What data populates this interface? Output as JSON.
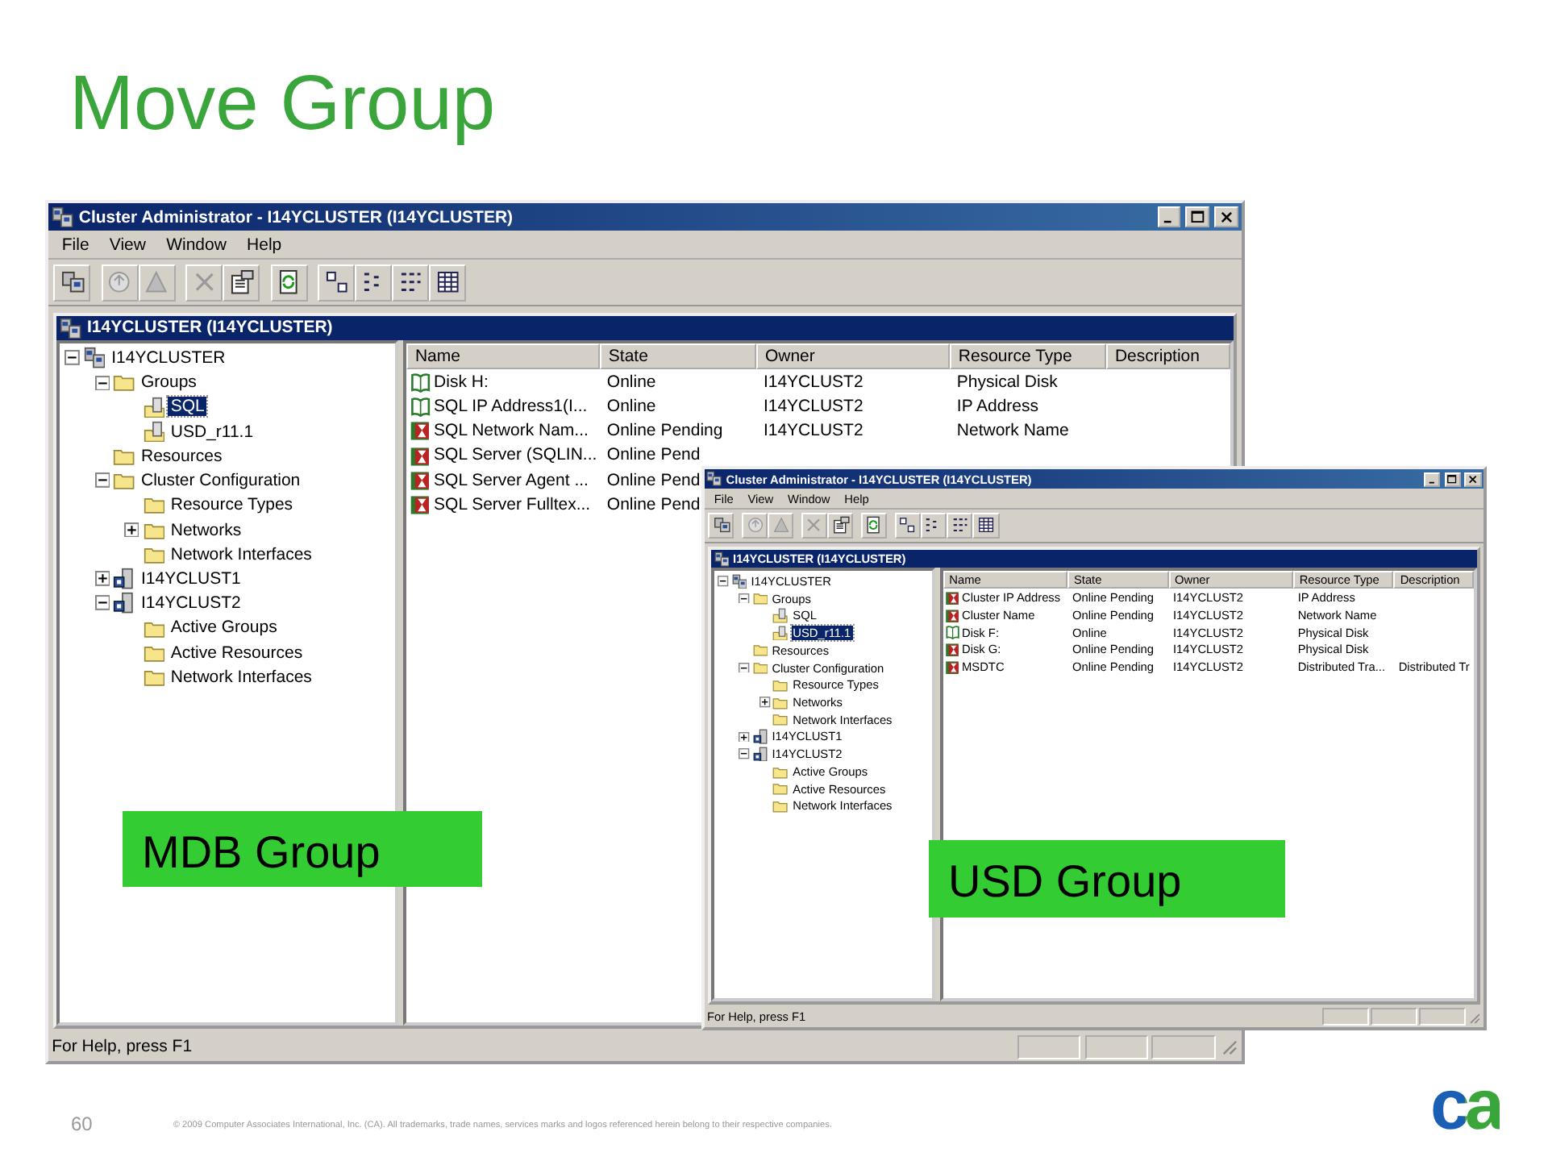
{
  "slide_title": "Move Group",
  "windows": [
    {
      "title": "Cluster Administrator - I14YCLUSTER (I14YCLUSTER)",
      "menu": [
        "File",
        "View",
        "Window",
        "Help"
      ],
      "child_title": "I14YCLUSTER (I14YCLUSTER)",
      "tree": [
        {
          "label": "I14YCLUSTER",
          "kind": "cluster",
          "expanded": true,
          "selected": false,
          "children": [
            {
              "label": "Groups",
              "kind": "folder",
              "expanded": true,
              "selected": false,
              "children": [
                {
                  "label": "SQL",
                  "kind": "group",
                  "selected": true
                },
                {
                  "label": "USD_r11.1",
                  "kind": "group",
                  "selected": false
                }
              ]
            },
            {
              "label": "Resources",
              "kind": "folder",
              "selected": false
            },
            {
              "label": "Cluster Configuration",
              "kind": "folder",
              "expanded": true,
              "selected": false,
              "children": [
                {
                  "label": "Resource Types",
                  "kind": "folder",
                  "selected": false
                },
                {
                  "label": "Networks",
                  "kind": "folder",
                  "expanded": false,
                  "selected": false
                },
                {
                  "label": "Network Interfaces",
                  "kind": "folder",
                  "selected": false
                }
              ]
            },
            {
              "label": "I14YCLUST1",
              "kind": "node",
              "expanded": false,
              "selected": false
            },
            {
              "label": "I14YCLUST2",
              "kind": "node",
              "expanded": true,
              "selected": false,
              "children": [
                {
                  "label": "Active Groups",
                  "kind": "folder",
                  "selected": false
                },
                {
                  "label": "Active Resources",
                  "kind": "folder",
                  "selected": false
                },
                {
                  "label": "Network Interfaces",
                  "kind": "folder",
                  "selected": false
                }
              ]
            }
          ]
        }
      ],
      "columns": [
        "Name",
        "State",
        "Owner",
        "Resource Type",
        "Description"
      ],
      "rows": [
        {
          "kind": "online",
          "cells": [
            "Disk H:",
            "Online",
            "I14YCLUST2",
            "Physical Disk"
          ]
        },
        {
          "kind": "online",
          "cells": [
            "SQL IP Address1(I...",
            "Online",
            "I14YCLUST2",
            "IP Address"
          ]
        },
        {
          "kind": "pending",
          "cells": [
            "SQL Network Nam...",
            "Online Pending",
            "I14YCLUST2",
            "Network Name"
          ]
        },
        {
          "kind": "pending",
          "cells": [
            "SQL Server (SQLIN...",
            "Online Pend"
          ]
        },
        {
          "kind": "pending",
          "cells": [
            "SQL Server Agent ...",
            "Online Pend"
          ]
        },
        {
          "kind": "pending",
          "cells": [
            "SQL Server Fulltex...",
            "Online Pend"
          ]
        }
      ],
      "status_bar": "For Help, press F1"
    },
    {
      "title": "Cluster Administrator - I14YCLUSTER (I14YCLUSTER)",
      "menu": [
        "File",
        "View",
        "Window",
        "Help"
      ],
      "child_title": "I14YCLUSTER (I14YCLUSTER)",
      "tree": [
        {
          "label": "I14YCLUSTER",
          "kind": "cluster",
          "expanded": true,
          "selected": false,
          "children": [
            {
              "label": "Groups",
              "kind": "folder",
              "expanded": true,
              "selected": false,
              "children": [
                {
                  "label": "SQL",
                  "kind": "group",
                  "selected": false
                },
                {
                  "label": "USD_r11.1",
                  "kind": "group",
                  "selected": true
                }
              ]
            },
            {
              "label": "Resources",
              "kind": "folder",
              "selected": false
            },
            {
              "label": "Cluster Configuration",
              "kind": "folder",
              "expanded": true,
              "selected": false,
              "children": [
                {
                  "label": "Resource Types",
                  "kind": "folder",
                  "selected": false
                },
                {
                  "label": "Networks",
                  "kind": "folder",
                  "expanded": false,
                  "selected": false
                },
                {
                  "label": "Network Interfaces",
                  "kind": "folder",
                  "selected": false
                }
              ]
            },
            {
              "label": "I14YCLUST1",
              "kind": "node",
              "expanded": false,
              "selected": false
            },
            {
              "label": "I14YCLUST2",
              "kind": "node",
              "expanded": true,
              "selected": false,
              "children": [
                {
                  "label": "Active Groups",
                  "kind": "folder",
                  "selected": false
                },
                {
                  "label": "Active Resources",
                  "kind": "folder",
                  "selected": false
                },
                {
                  "label": "Network Interfaces",
                  "kind": "folder",
                  "selected": false
                }
              ]
            }
          ]
        }
      ],
      "columns": [
        "Name",
        "State",
        "Owner",
        "Resource Type",
        "Description"
      ],
      "rows": [
        {
          "kind": "pending",
          "cells": [
            "Cluster IP Address",
            "Online Pending",
            "I14YCLUST2",
            "IP Address"
          ]
        },
        {
          "kind": "pending",
          "cells": [
            "Cluster Name",
            "Online Pending",
            "I14YCLUST2",
            "Network Name"
          ]
        },
        {
          "kind": "online",
          "cells": [
            "Disk F:",
            "Online",
            "I14YCLUST2",
            "Physical Disk"
          ]
        },
        {
          "kind": "pending",
          "cells": [
            "Disk G:",
            "Online Pending",
            "I14YCLUST2",
            "Physical Disk"
          ]
        },
        {
          "kind": "pending",
          "cells": [
            "MSDTC",
            "Online Pending",
            "I14YCLUST2",
            "Distributed Tra...",
            "Distributed Tr"
          ]
        }
      ],
      "status_bar": "For Help, press F1"
    }
  ],
  "labels": [
    "MDB Group",
    "USD Group"
  ],
  "footer": {
    "page": "60",
    "copyright": "© 2009 Computer Associates International, Inc. (CA). All trademarks, trade names, services marks and logos referenced herein belong to their respective companies.",
    "logo": "ca"
  }
}
